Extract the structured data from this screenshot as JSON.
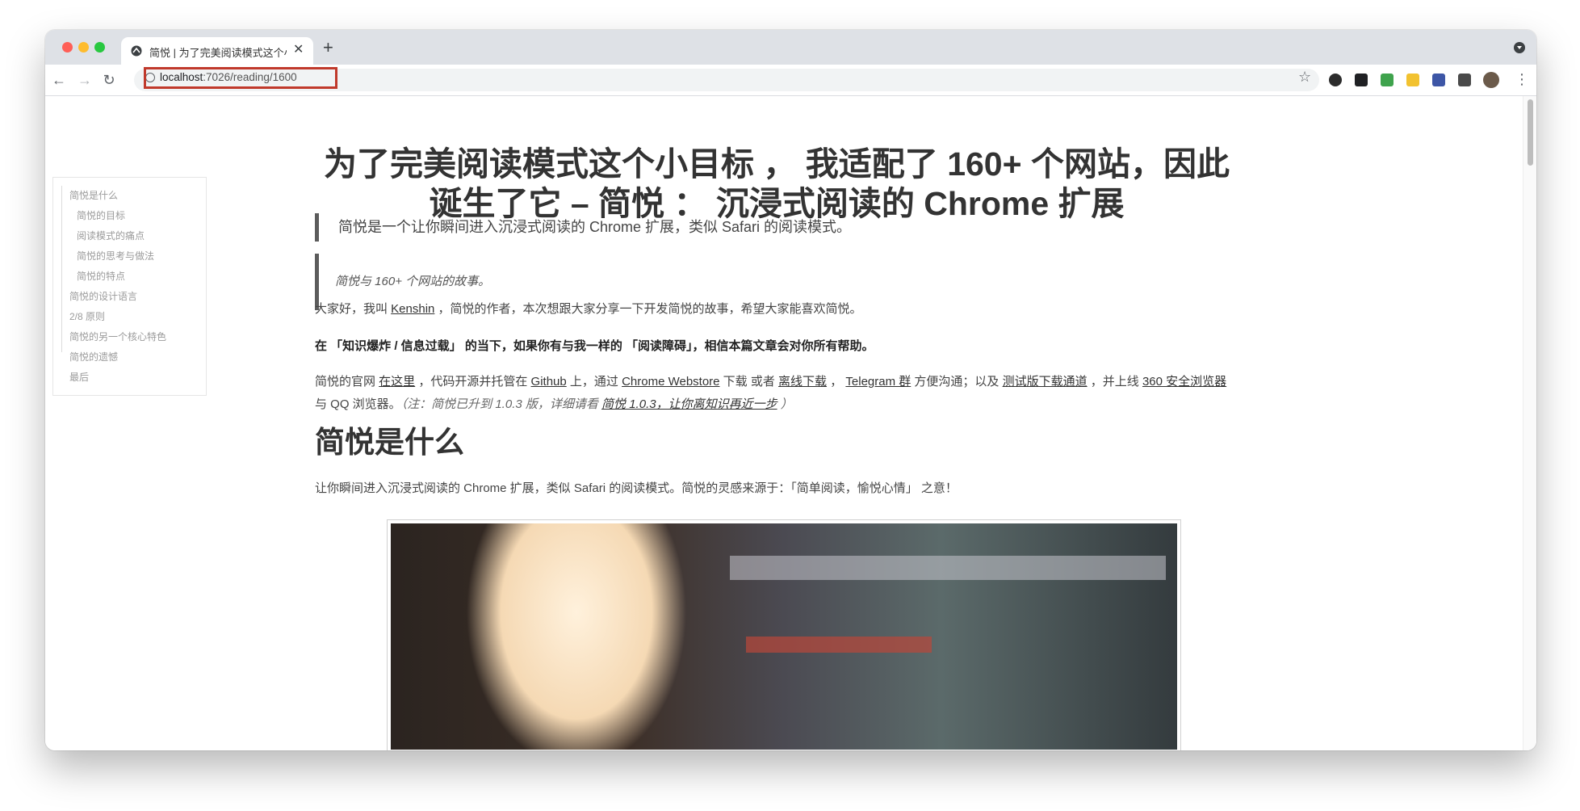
{
  "browser": {
    "tab_title": "简悦 | 为了完美阅读模式这个小目标",
    "tab_close": "✕",
    "new_tab": "+",
    "url_host": "localhost",
    "url_path": ":7026/reading/1600",
    "back": "←",
    "forward": "→",
    "reload": "↻",
    "star": "☆",
    "menu": "⋮",
    "url_highlight_color": "#c0392b"
  },
  "toc": {
    "items": [
      "简悦是什么",
      "简悦的目标",
      "阅读模式的痛点",
      "简悦的思考与做法",
      "简悦的特点",
      "简悦的设计语言",
      "2/8 原则",
      "简悦的另一个核心特色",
      "简悦的遗憾",
      "最后"
    ]
  },
  "article": {
    "title_line1": "为了完美阅读模式这个小目标 ， 我适配了 160+ 个网站，因此",
    "title_line2": "诞生了它 – 简悦 ： 沉浸式阅读的 Chrome 扩展",
    "lead_quote": "简悦是一个让你瞬间进入沉浸式阅读的 Chrome 扩展，类似 Safari 的阅读模式。",
    "story_quote": "简悦与 160+ 个网站的故事。",
    "intro_a": "大家好，我叫 ",
    "intro_link": "Kenshin",
    "intro_b": " ，简悦的作者，本次想跟大家分享一下开发简悦的故事，希望大家能喜欢简悦。",
    "bold_line": "在 「知识爆炸 / 信息过载」 的当下，如果你有与我一样的 「阅读障碍」，相信本篇文章会对你所有帮助。",
    "links_1": "简悦的官网 ",
    "link_site": "在这里",
    "links_2": " ，代码开源并托管在 ",
    "link_github": "Github",
    "links_3": " 上，通过 ",
    "link_webstore": "Chrome Webstore",
    "links_4": " 下载 或者 ",
    "link_offline": "离线下载",
    "links_5": " ， ",
    "link_telegram": "Telegram 群",
    "links_6": " 方便沟通；以及 ",
    "link_beta": "测试版下载通道",
    "links_7": " ，并上线 ",
    "link_360": "360 安全浏览器",
    "links_8": " 与 QQ 浏览器。",
    "note_a": "（注：简悦已升到 1.0.3 版，详细请看 ",
    "note_link": "简悦 1.0.3，让你离知识再近一步",
    "note_b": " ）",
    "h2": "简悦是什么",
    "what_para": "让你瞬间进入沉浸式阅读的 Chrome 扩展，类似 Safari 的阅读模式。简悦的灵感来源于：「简单阅读，愉悦心情」 之意！"
  }
}
